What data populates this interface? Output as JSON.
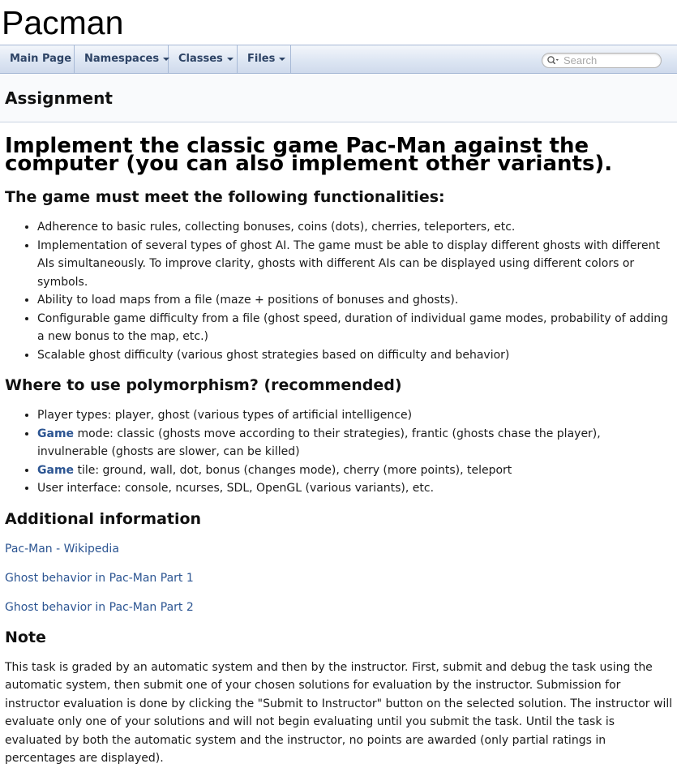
{
  "page": {
    "title": "Pacman"
  },
  "navbar": {
    "items": [
      {
        "label": "Main Page"
      },
      {
        "label": "Namespaces"
      },
      {
        "label": "Classes"
      },
      {
        "label": "Files"
      }
    ],
    "search_placeholder": "Search"
  },
  "subheader": {
    "title": "Assignment"
  },
  "content": {
    "heading": "Implement the classic game Pac-Man against the computer (you can also implement other variants).",
    "functionalities": {
      "title": "The game must meet the following functionalities:",
      "items": [
        "Adherence to basic rules, collecting bonuses, coins (dots), cherries, teleporters, etc.",
        "Implementation of several types of ghost AI. The game must be able to display different ghosts with different AIs simultaneously. To improve clarity, ghosts with different AIs can be displayed using different colors or symbols.",
        "Ability to load maps from a file (maze + positions of bonuses and ghosts).",
        "Configurable game difficulty from a file (ghost speed, duration of individual game modes, probability of adding a new bonus to the map, etc.)",
        "Scalable ghost difficulty (various ghost strategies based on difficulty and behavior)"
      ]
    },
    "polymorphism": {
      "title": "Where to use polymorphism? (recommended)",
      "item1": "Player types: player, ghost (various types of artificial intelligence)",
      "item2_keyword": "Game",
      "item2_rest": " mode: classic (ghosts move according to their strategies), frantic (ghosts chase the player), invulnerable (ghosts are slower, can be killed)",
      "item3_keyword": "Game",
      "item3_rest": " tile: ground, wall, dot, bonus (changes mode), cherry (more points), teleport",
      "item4": "User interface: console, ncurses, SDL, OpenGL (various variants), etc."
    },
    "additional": {
      "title": "Additional information",
      "links": [
        "Pac-Man - Wikipedia",
        "Ghost behavior in Pac-Man Part 1",
        "Ghost behavior in Pac-Man Part 2"
      ]
    },
    "note": {
      "title": "Note",
      "text": "This task is graded by an automatic system and then by the instructor. First, submit and debug the task using the automatic system, then submit one of your chosen solutions for evaluation by the instructor. Submission for instructor evaluation is done by clicking the \"Submit to Instructor\" button on the selected solution. The instructor will evaluate only one of your solutions and will not begin evaluating until you submit the task. Until the task is evaluated by both the automatic system and the instructor, no points are awarded (only partial ratings in percentages are displayed)."
    }
  },
  "colors": {
    "link": "#2c5592",
    "nav_text": "#2e4466",
    "nav_border": "#a7b9d6"
  }
}
